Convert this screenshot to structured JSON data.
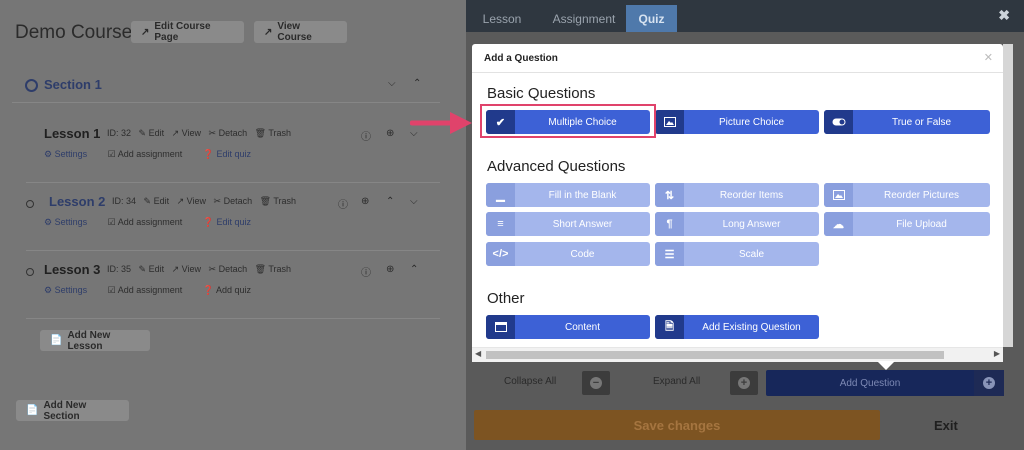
{
  "course": {
    "title": "Demo Course",
    "edit_course_page": "Edit Course Page",
    "view_course": "View Course",
    "add_new_lesson": "Add New Lesson",
    "add_new_section": "Add New Section"
  },
  "section": {
    "title": "Section 1"
  },
  "lessons": [
    {
      "title": "Lesson 1",
      "id": "ID: 32",
      "edit": "Edit",
      "view": "View",
      "detach": "Detach",
      "trash": "Trash",
      "settings": "Settings",
      "add_assignment": "Add assignment",
      "quiz": "Edit quiz"
    },
    {
      "title": "Lesson 2",
      "id": "ID: 34",
      "edit": "Edit",
      "view": "View",
      "detach": "Detach",
      "trash": "Trash",
      "settings": "Settings",
      "add_assignment": "Add assignment",
      "quiz": "Edit quiz"
    },
    {
      "title": "Lesson 3",
      "id": "ID: 35",
      "edit": "Edit",
      "view": "View",
      "detach": "Detach",
      "trash": "Trash",
      "settings": "Settings",
      "add_assignment": "Add assignment",
      "quiz": "Add quiz"
    }
  ],
  "tabs": {
    "lesson": "Lesson",
    "assignment": "Assignment",
    "quiz": "Quiz"
  },
  "panel": {
    "collapse_all": "Collapse All",
    "expand_all": "Expand All",
    "add_question": "Add Question",
    "save_changes": "Save changes",
    "exit": "Exit"
  },
  "modal": {
    "title": "Add a Question",
    "basic_heading": "Basic Questions",
    "advanced_heading": "Advanced Questions",
    "other_heading": "Other",
    "basic": [
      "Multiple Choice",
      "Picture Choice",
      "True or False"
    ],
    "advanced": [
      "Fill in the Blank",
      "Reorder Items",
      "Reorder Pictures",
      "Short Answer",
      "Long Answer",
      "File Upload",
      "Code",
      "Scale"
    ],
    "other": [
      "Content",
      "Add Existing Question"
    ]
  },
  "colors": {
    "highlight": "#e0436b",
    "button_dark": "#3d61d6",
    "button_light": "#a4b6ec",
    "save": "#7d5422"
  }
}
